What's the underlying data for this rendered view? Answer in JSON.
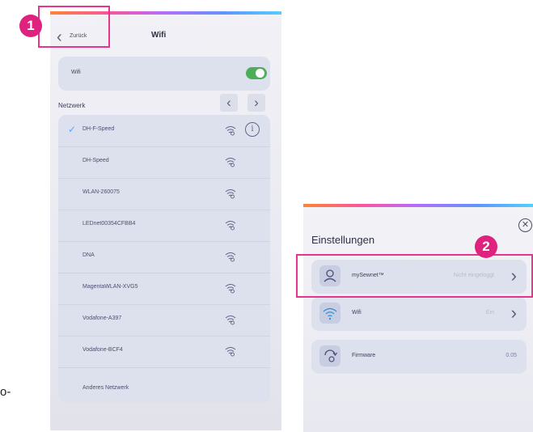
{
  "left_screen": {
    "back_label": "Zurück",
    "title": "Wifi",
    "wifi_label": "Wifi",
    "network_title": "Netzwerk",
    "networks": [
      {
        "name": "DH-F-Speed",
        "connected": true
      },
      {
        "name": "DH-Speed",
        "connected": false
      },
      {
        "name": "WLAN-260075",
        "connected": false
      },
      {
        "name": "LEDnet00354CFBB4",
        "connected": false
      },
      {
        "name": "DNA",
        "connected": false
      },
      {
        "name": "MagentaWLAN-XVG5",
        "connected": false
      },
      {
        "name": "Vodafone-A397",
        "connected": false
      },
      {
        "name": "Vodafone-BCF4",
        "connected": false
      }
    ],
    "other_network": "Anderes Netzwerk"
  },
  "annotations": {
    "badge1": "1",
    "badge2": "2",
    "side_text": "o-"
  },
  "right_screen": {
    "title": "Einstellungen",
    "rows": [
      {
        "label": "mySewnet™",
        "value": "Nicht eingeloggt",
        "icon": "user-icon"
      },
      {
        "label": "Wifi",
        "value": "Ein",
        "icon": "wifi-icon"
      },
      {
        "label": "Firmware",
        "value": "0.05",
        "icon": "firmware-update-icon"
      }
    ]
  },
  "colors": {
    "accent": "#e0227f",
    "toggle_on": "#4caf57",
    "check": "#5da3ff"
  }
}
